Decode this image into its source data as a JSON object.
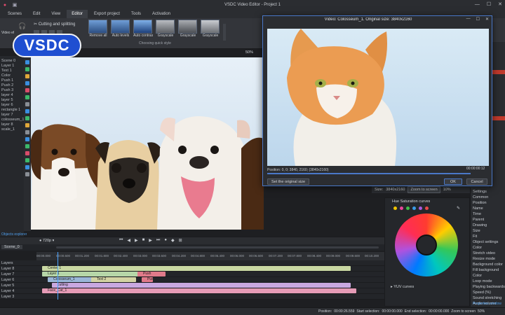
{
  "titlebar": {
    "title": "VSDC Video Editor - Project 1"
  },
  "menu": [
    "Scenes",
    "Edit",
    "View",
    "Editor",
    "Export project",
    "Tools",
    "Activation"
  ],
  "menu_active": 3,
  "ribbon": {
    "video_effects": "Video effects",
    "cutting": "Cutting and splitting",
    "quick_styles": [
      "Remove all",
      "Auto levels",
      "Auto contrast",
      "Grayscale",
      "Grayscale",
      "Grayscale"
    ],
    "group_label": "Choosing quick style",
    "zoom": "50%"
  },
  "logo": {
    "text": "VSDC"
  },
  "objects": [
    "Scene 0",
    "Layer 1",
    "Text 1",
    "Color",
    "Push 1",
    "Push 2",
    "Push 3",
    "layer 4",
    "layer 5",
    "layer 6",
    "rectangle 1",
    "layer 7",
    "colosseum_1",
    "layer 8",
    "scale_1"
  ],
  "objects_footer": "Objects explorer",
  "preview": {
    "title": "Video: Colosseum_1. Original size: 3840x2160",
    "position": "Position:  0, 0; 3840, 2160; (3840x2160)",
    "time": "00:00:00:12",
    "set_original": "Set the original size",
    "ok": "OK",
    "cancel": "Cancel",
    "size_label": "Size:",
    "size": "3840x2160",
    "zoom_to_screen": "Zoom to screen",
    "zoom": "10%"
  },
  "timeline": {
    "zoom": "720p",
    "scene": "Scene_0",
    "layers": [
      "Layers",
      "Layer 8",
      "Layer 7",
      "Layer 6",
      "Layer 5",
      "Layer 4",
      "Layer 3"
    ],
    "ruler": [
      "00:00.000",
      "00:00.600",
      "00:01.200",
      "00:01.800",
      "00:02.400",
      "00:03.000",
      "00:03.600",
      "00:04.200",
      "00:04.800",
      "00:05.400",
      "00:06.000",
      "00:06.600",
      "00:07.200",
      "00:07.800",
      "00:08.400",
      "00:09.000",
      "00:09.600",
      "00:10.200"
    ],
    "clips": [
      {
        "label": "Center 1",
        "row": 1,
        "color": "#c8d7a2"
      },
      {
        "label": "Layer 1",
        "row": 2,
        "color": "#b6d6a8"
      },
      {
        "label": "Push",
        "row": 2,
        "color": "#e07a8a"
      },
      {
        "label": "Colosseum_1",
        "row": 3,
        "color": "#9ab6d8"
      },
      {
        "label": "Text 2",
        "row": 3,
        "color": "#d3d3a3"
      },
      {
        "label": "Push",
        "row": 3,
        "color": "#e07a8a"
      },
      {
        "label": "cutting",
        "row": 4,
        "color": "#c9a8e0"
      },
      {
        "label": "Face_Cat_1",
        "row": 5,
        "color": "#e59bb6"
      }
    ]
  },
  "hue": {
    "title": "Hue Saturation curves",
    "yuv": "YUV curves"
  },
  "props": [
    "Settings",
    "Common",
    "Position",
    "Name",
    "Time",
    "Parent",
    "Drawing",
    "Size",
    "Fit",
    "Object settings",
    "Color",
    "Stretch video",
    "Resize mode",
    "Background color",
    "Fill background",
    "Color",
    "Loop mode",
    "Playing backwards",
    "Speed (%)",
    "Sound stretching",
    "Audio volume",
    "Audio track",
    "Split to video"
  ],
  "props_footer": "Properties window",
  "status": {
    "position_label": "Position:",
    "position": "00:00:26.559",
    "start_label": "Start selection:",
    "start": "00:00:00.000",
    "end_label": "End selection:",
    "end": "00:00:00.000",
    "zoom_label": "Zoom to screen",
    "zoom": "50%"
  },
  "colors": {
    "accent": "#2e6fd8",
    "dialog_border": "#4a78c8",
    "logo": "#1f4fd1"
  }
}
